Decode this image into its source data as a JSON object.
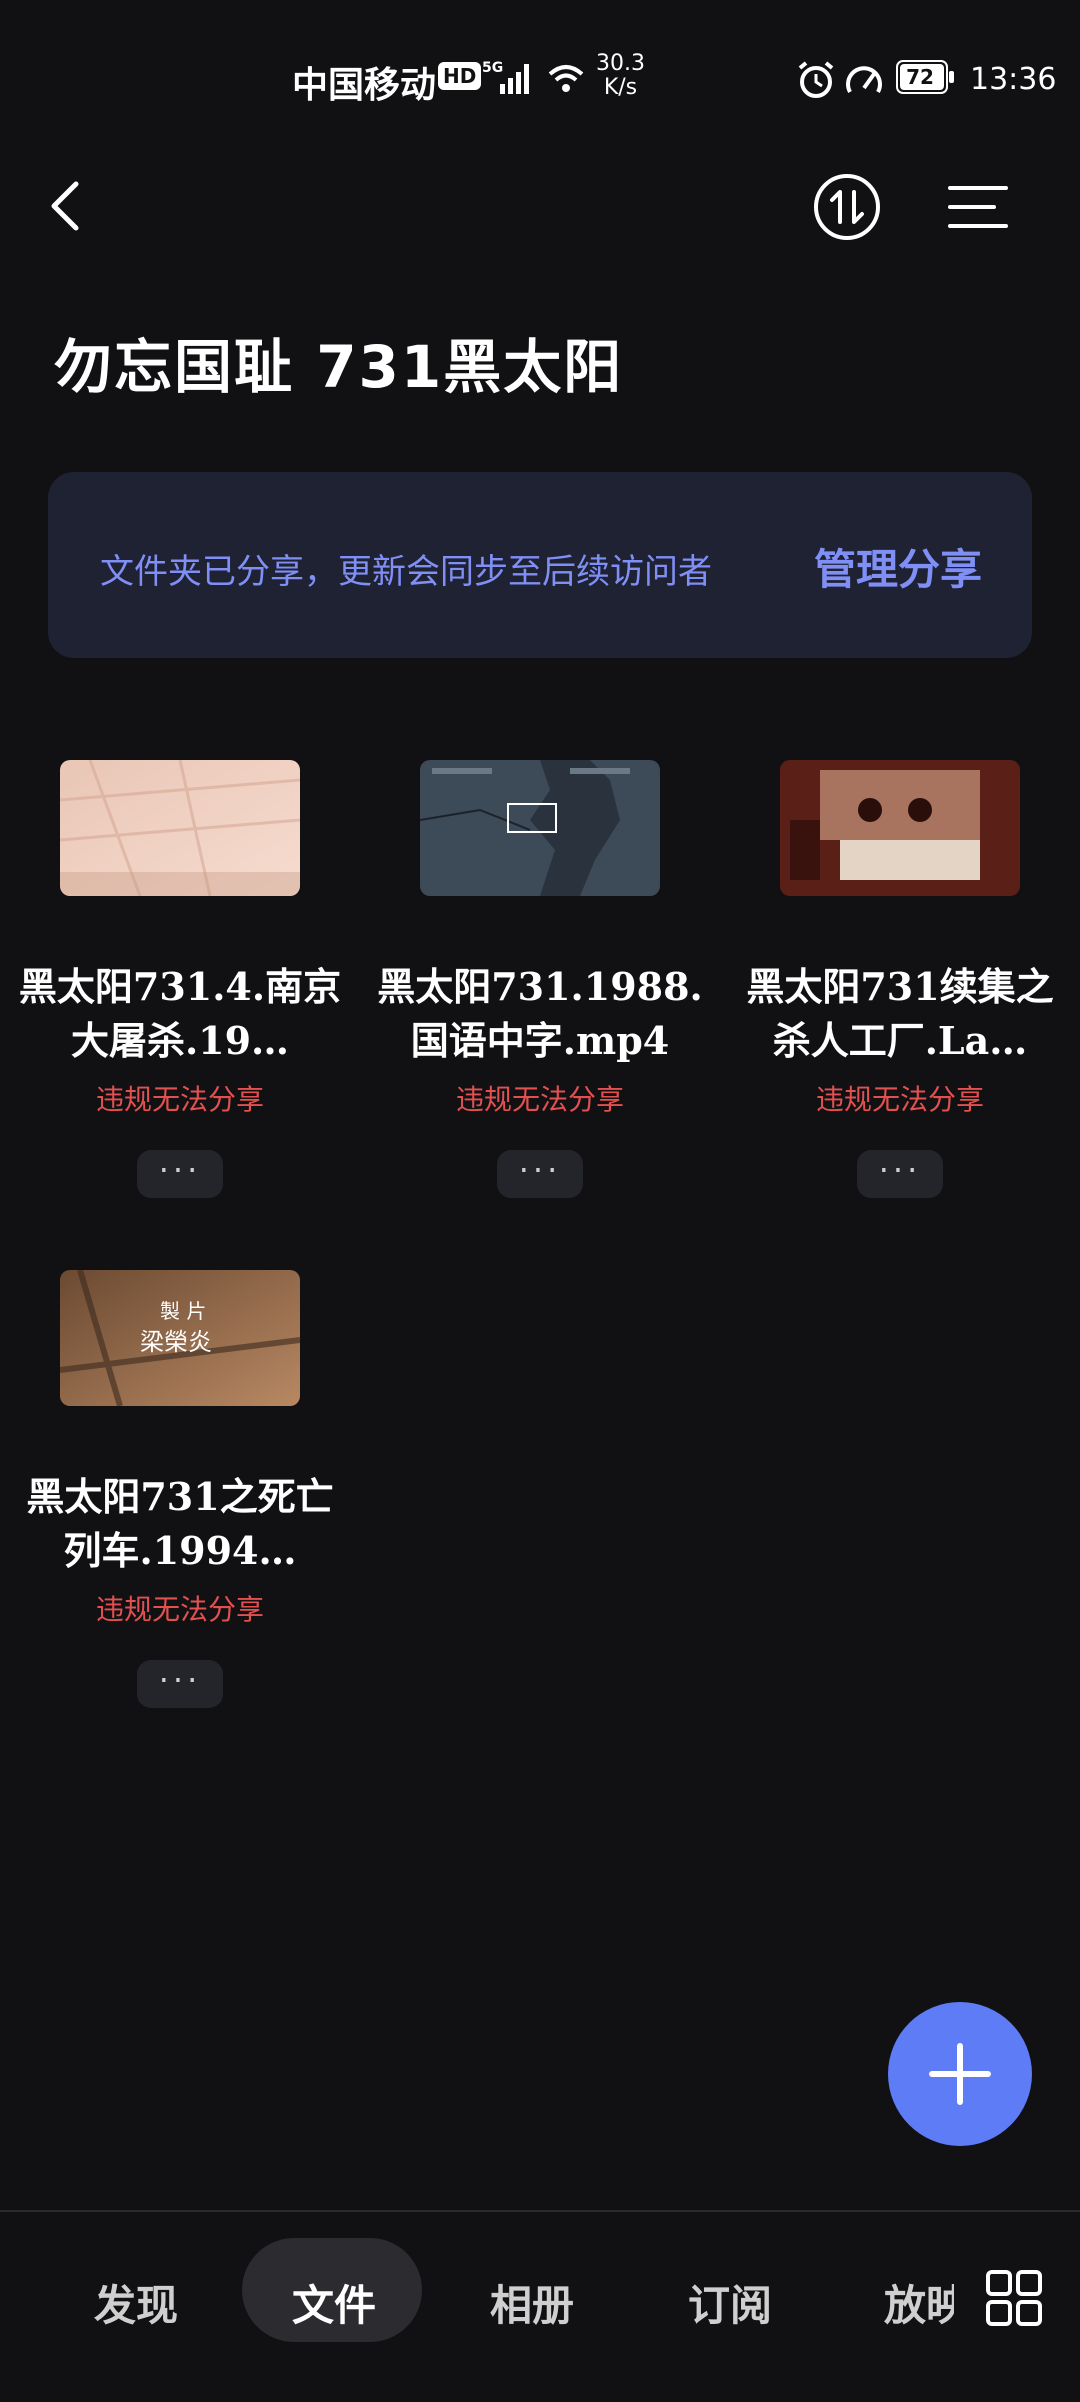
{
  "status_bar": {
    "carrier": "中国移动",
    "hd_badge": "HD",
    "net_speed_value": "30.3",
    "net_speed_unit": "K/s",
    "battery": "72",
    "time": "13:36"
  },
  "header": {
    "back_icon": "chevron-left-icon",
    "sort_icon": "sort-arrows-icon",
    "menu_icon": "menu-lines-icon"
  },
  "page": {
    "title": "勿忘国耻 731黑太阳"
  },
  "share_banner": {
    "text": "文件夹已分享，更新会同步至后续访问者",
    "action_label": "管理分享"
  },
  "files": [
    {
      "name": "黑太阳731.4.南京大屠杀.19…",
      "status": "违规无法分享",
      "more": "···"
    },
    {
      "name": "黑太阳731.1988.国语中字.mp4",
      "status": "违规无法分享",
      "more": "···"
    },
    {
      "name": "黑太阳731续集之杀人工厂.La…",
      "status": "违规无法分享",
      "more": "···"
    },
    {
      "name": "黑太阳731之死亡列车.1994…",
      "status": "违规无法分享",
      "more": "···"
    }
  ],
  "thumbnail_texts": {
    "t4_line1": "製  片",
    "t4_line2": "梁榮炎"
  },
  "fab": {
    "icon": "plus-icon"
  },
  "bottom_nav": {
    "items": [
      "发现",
      "文件",
      "相册",
      "订阅",
      "放映"
    ],
    "active": "文件",
    "grid_icon": "grid-icon"
  },
  "colors": {
    "background": "#111114",
    "accent": "#5d7cf5",
    "banner": "#1f2233",
    "banner_text": "#7f8ff5",
    "warning": "#e2504f"
  }
}
